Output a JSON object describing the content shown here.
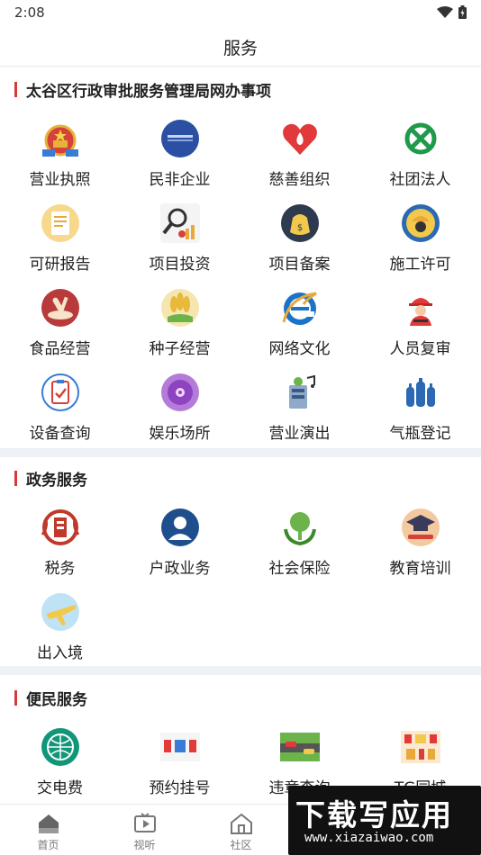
{
  "status_bar": {
    "time": "2:08"
  },
  "header": {
    "title": "服务"
  },
  "sections": {
    "government_office": {
      "title": "太谷区行政审批服务管理局网办事项",
      "items": [
        {
          "label": "营业执照",
          "icon": "national-emblem-icon"
        },
        {
          "label": "民非企业",
          "icon": "blue-seal-icon"
        },
        {
          "label": "慈善组织",
          "icon": "charity-heart-icon"
        },
        {
          "label": "社团法人",
          "icon": "green-knot-icon"
        },
        {
          "label": "可研报告",
          "icon": "report-document-icon"
        },
        {
          "label": "项目投资",
          "icon": "investment-magnifier-icon"
        },
        {
          "label": "项目备案",
          "icon": "money-bag-icon"
        },
        {
          "label": "施工许可",
          "icon": "construction-worker-icon"
        },
        {
          "label": "食品经营",
          "icon": "food-plate-icon"
        },
        {
          "label": "种子经营",
          "icon": "wheat-icon"
        },
        {
          "label": "网络文化",
          "icon": "internet-explorer-icon"
        },
        {
          "label": "人员复审",
          "icon": "worker-helmet-icon"
        },
        {
          "label": "设备查询",
          "icon": "clipboard-check-icon"
        },
        {
          "label": "娱乐场所",
          "icon": "music-disc-icon"
        },
        {
          "label": "营业演出",
          "icon": "performance-icon"
        },
        {
          "label": "气瓶登记",
          "icon": "gas-cylinder-icon"
        }
      ]
    },
    "gov_services": {
      "title": "政务服务",
      "items": [
        {
          "label": "税务",
          "icon": "tax-emblem-icon"
        },
        {
          "label": "户政业务",
          "icon": "person-icon"
        },
        {
          "label": "社会保险",
          "icon": "social-insurance-icon"
        },
        {
          "label": "教育培训",
          "icon": "graduation-cap-icon"
        },
        {
          "label": "出入境",
          "icon": "airplane-icon"
        }
      ]
    },
    "convenience": {
      "title": "便民服务",
      "items": [
        {
          "label": "交电费",
          "icon": "state-grid-icon"
        },
        {
          "label": "预约挂号",
          "icon": "appointment-icon"
        },
        {
          "label": "违章查询",
          "icon": "traffic-violation-icon"
        },
        {
          "label": "TG同城",
          "icon": "local-shop-icon"
        }
      ]
    }
  },
  "tabbar": {
    "tabs": [
      {
        "label": "首页",
        "icon": "home-icon"
      },
      {
        "label": "视听",
        "icon": "video-icon"
      },
      {
        "label": "社区",
        "icon": "community-icon"
      }
    ]
  },
  "watermark": {
    "main": "下载写应用",
    "sub": "www.xiazaiwao.com"
  },
  "colors": {
    "accent_red": "#d83a3a",
    "divider": "#eef1f6"
  }
}
